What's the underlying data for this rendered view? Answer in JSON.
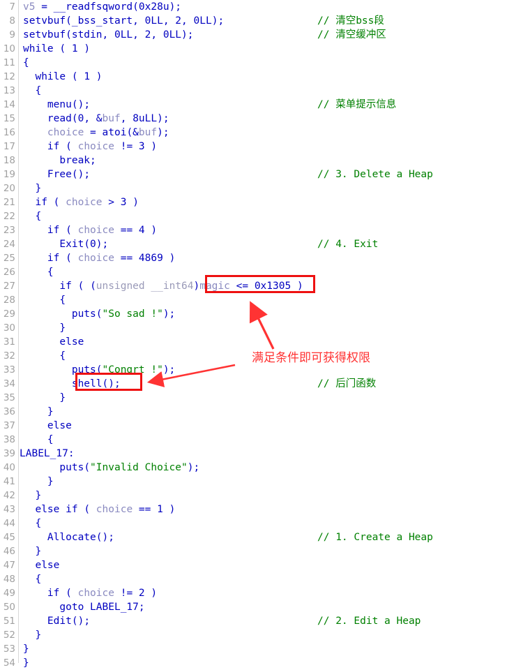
{
  "view": {
    "kind": "decompiler-pseudocode",
    "background": "#ffffff",
    "comment_color": "#008000",
    "keyword_color": "#0000c0",
    "variable_color": "#8a8ac0",
    "string_color": "#008000",
    "linenumber_color": "#a0a0a0",
    "annotation_color": "#ff3333",
    "highlight_box_color": "#ee1111"
  },
  "lines": [
    {
      "n": "7",
      "code": "v5 = __readfsqword(0x28u);",
      "comment": ""
    },
    {
      "n": "8",
      "code": "setvbuf(_bss_start, 0LL, 2, 0LL);",
      "comment": "// 清空bss段"
    },
    {
      "n": "9",
      "code": "setvbuf(stdin, 0LL, 2, 0LL);",
      "comment": "// 清空缓冲区"
    },
    {
      "n": "10",
      "code": "while ( 1 )",
      "comment": ""
    },
    {
      "n": "11",
      "code": "{",
      "comment": ""
    },
    {
      "n": "12",
      "code": "  while ( 1 )",
      "comment": ""
    },
    {
      "n": "13",
      "code": "  {",
      "comment": ""
    },
    {
      "n": "14",
      "code": "    menu();",
      "comment": "// 菜单提示信息"
    },
    {
      "n": "15",
      "code": "    read(0, &buf, 8uLL);",
      "comment": ""
    },
    {
      "n": "16",
      "code": "    choice = atoi(&buf);",
      "comment": ""
    },
    {
      "n": "17",
      "code": "    if ( choice != 3 )",
      "comment": ""
    },
    {
      "n": "18",
      "code": "      break;",
      "comment": ""
    },
    {
      "n": "19",
      "code": "    Free();",
      "comment": "// 3. Delete a Heap"
    },
    {
      "n": "20",
      "code": "  }",
      "comment": ""
    },
    {
      "n": "21",
      "code": "  if ( choice > 3 )",
      "comment": ""
    },
    {
      "n": "22",
      "code": "  {",
      "comment": ""
    },
    {
      "n": "23",
      "code": "    if ( choice == 4 )",
      "comment": ""
    },
    {
      "n": "24",
      "code": "      Exit(0);",
      "comment": "// 4. Exit"
    },
    {
      "n": "25",
      "code": "    if ( choice == 4869 )",
      "comment": ""
    },
    {
      "n": "26",
      "code": "    {",
      "comment": ""
    },
    {
      "n": "27",
      "code": "      if ( (unsigned __int64)magic <= 0x1305 )",
      "comment": ""
    },
    {
      "n": "28",
      "code": "      {",
      "comment": ""
    },
    {
      "n": "29",
      "code": "        puts(\"So sad !\");",
      "comment": ""
    },
    {
      "n": "30",
      "code": "      }",
      "comment": ""
    },
    {
      "n": "31",
      "code": "      else",
      "comment": ""
    },
    {
      "n": "32",
      "code": "      {",
      "comment": ""
    },
    {
      "n": "33",
      "code": "        puts(\"Congrt !\");",
      "comment": ""
    },
    {
      "n": "34",
      "code": "        shell();",
      "comment": "// 后门函数"
    },
    {
      "n": "35",
      "code": "      }",
      "comment": ""
    },
    {
      "n": "36",
      "code": "    }",
      "comment": ""
    },
    {
      "n": "37",
      "code": "    else",
      "comment": ""
    },
    {
      "n": "38",
      "code": "    {",
      "comment": ""
    },
    {
      "n": "39",
      "code": "LABEL_17:",
      "comment": "",
      "nogutterpad": true
    },
    {
      "n": "40",
      "code": "      puts(\"Invalid Choice\");",
      "comment": ""
    },
    {
      "n": "41",
      "code": "    }",
      "comment": ""
    },
    {
      "n": "42",
      "code": "  }",
      "comment": ""
    },
    {
      "n": "43",
      "code": "  else if ( choice == 1 )",
      "comment": ""
    },
    {
      "n": "44",
      "code": "  {",
      "comment": ""
    },
    {
      "n": "45",
      "code": "    Allocate();",
      "comment": "// 1. Create a Heap"
    },
    {
      "n": "46",
      "code": "  }",
      "comment": ""
    },
    {
      "n": "47",
      "code": "  else",
      "comment": ""
    },
    {
      "n": "48",
      "code": "  {",
      "comment": ""
    },
    {
      "n": "49",
      "code": "    if ( choice != 2 )",
      "comment": ""
    },
    {
      "n": "50",
      "code": "      goto LABEL_17;",
      "comment": ""
    },
    {
      "n": "51",
      "code": "    Edit();",
      "comment": "// 2. Edit a Heap"
    },
    {
      "n": "52",
      "code": "  }",
      "comment": ""
    },
    {
      "n": "53",
      "code": "}",
      "comment": ""
    },
    {
      "n": "54",
      "code": "}",
      "comment": ""
    }
  ],
  "annotations": {
    "note_text": "满足条件即可获得权限",
    "magic_highlight": ")magic <= 0x1305 ",
    "shell_highlight": "shell();"
  }
}
